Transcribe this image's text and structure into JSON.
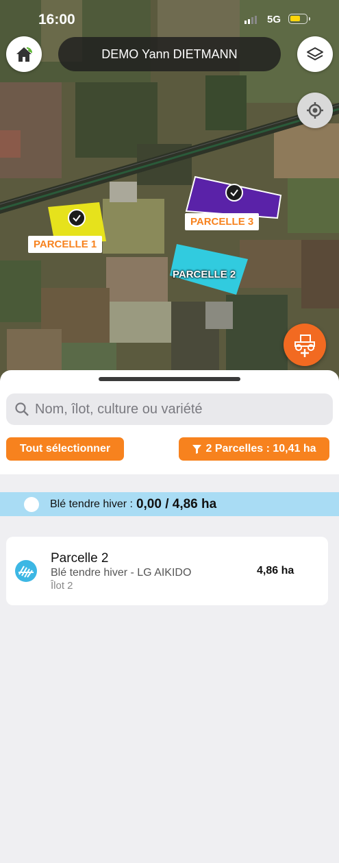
{
  "status_bar": {
    "time": "16:00",
    "network": "5G"
  },
  "header": {
    "farm_name": "DEMO Yann DIETMANN"
  },
  "map": {
    "parcels": [
      {
        "label": "PARCELLE 1",
        "color": "#e6e21c",
        "selected": true
      },
      {
        "label": "PARCELLE 2",
        "color": "#2fd2e8",
        "selected": false
      },
      {
        "label": "PARCELLE 3",
        "color": "#5a22a8",
        "selected": true
      }
    ]
  },
  "sheet": {
    "search_placeholder": "Nom, îlot, culture ou variété",
    "select_all_label": "Tout sélectionner",
    "filter_label": "2 Parcelles : 10,41 ha",
    "group": {
      "crop": "Blé tendre hiver :",
      "value": "0,00 / 4,86 ha"
    },
    "items": [
      {
        "name": "Parcelle 2",
        "crop": "Blé tendre hiver - LG AIKIDO",
        "ilot": "Îlot 2",
        "area": "4,86 ha"
      }
    ]
  },
  "colors": {
    "accent": "#f7821e",
    "group_bg": "#a9dcf4",
    "fab": "#f26a21"
  }
}
